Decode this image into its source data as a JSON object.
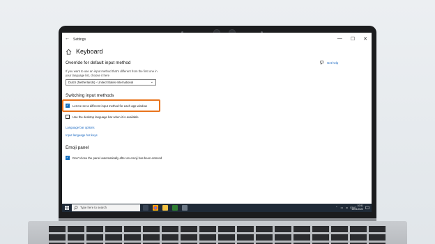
{
  "window": {
    "title": "Settings",
    "back_glyph": "←",
    "controls": [
      "—",
      "☐",
      "✕"
    ]
  },
  "page": {
    "title": "Keyboard",
    "help_link": "Get help"
  },
  "override": {
    "heading": "Override for default input method",
    "description": "If you want to use an input method that's different from the first one in your language list, choose it here",
    "selected": "Dutch (Netherlands) - United States-International"
  },
  "switching": {
    "heading": "Switching input methods",
    "per_app_label": "Let me set a different input method for each app window",
    "per_app_checked": true,
    "desktop_bar_label": "Use the desktop language bar when it is available",
    "desktop_bar_checked": false,
    "link_language_bar": "Language bar options",
    "link_hot_keys": "Input language hot keys"
  },
  "emoji": {
    "heading": "Emoji panel",
    "dont_close_label": "Don't close the panel automatically after an emoji has been entered",
    "dont_close_checked": true
  },
  "taskbar": {
    "search_placeholder": "Type here to search",
    "time": "10:51",
    "date": "16/11/2020",
    "tray_lang": "ENG"
  },
  "colors": {
    "accent": "#0f6cbd",
    "highlight": "#e8741d",
    "taskbar": "#1f2a37"
  }
}
